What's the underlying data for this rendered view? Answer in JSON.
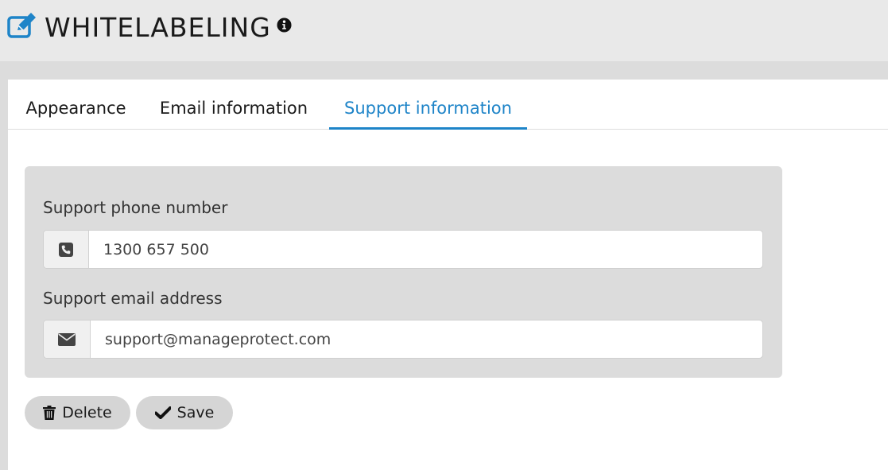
{
  "header": {
    "title": "WHITELABELING",
    "title_icon": "edit-icon",
    "info_icon": "info-circle-icon"
  },
  "tabs": [
    {
      "label": "Appearance",
      "active": false
    },
    {
      "label": "Email information",
      "active": false
    },
    {
      "label": "Support information",
      "active": true
    }
  ],
  "form": {
    "phone": {
      "label": "Support phone number",
      "icon": "phone-icon",
      "value": "1300 657 500"
    },
    "email": {
      "label": "Support email address",
      "icon": "envelope-icon",
      "value": "support@manageprotect.com"
    }
  },
  "actions": {
    "delete_label": "Delete",
    "save_label": "Save"
  },
  "colors": {
    "accent": "#1e84c8",
    "header_bg": "#e9e9e9",
    "panel_bg": "#ffffff",
    "form_bg": "#dcdcdc",
    "button_bg": "#d5d5d5"
  }
}
